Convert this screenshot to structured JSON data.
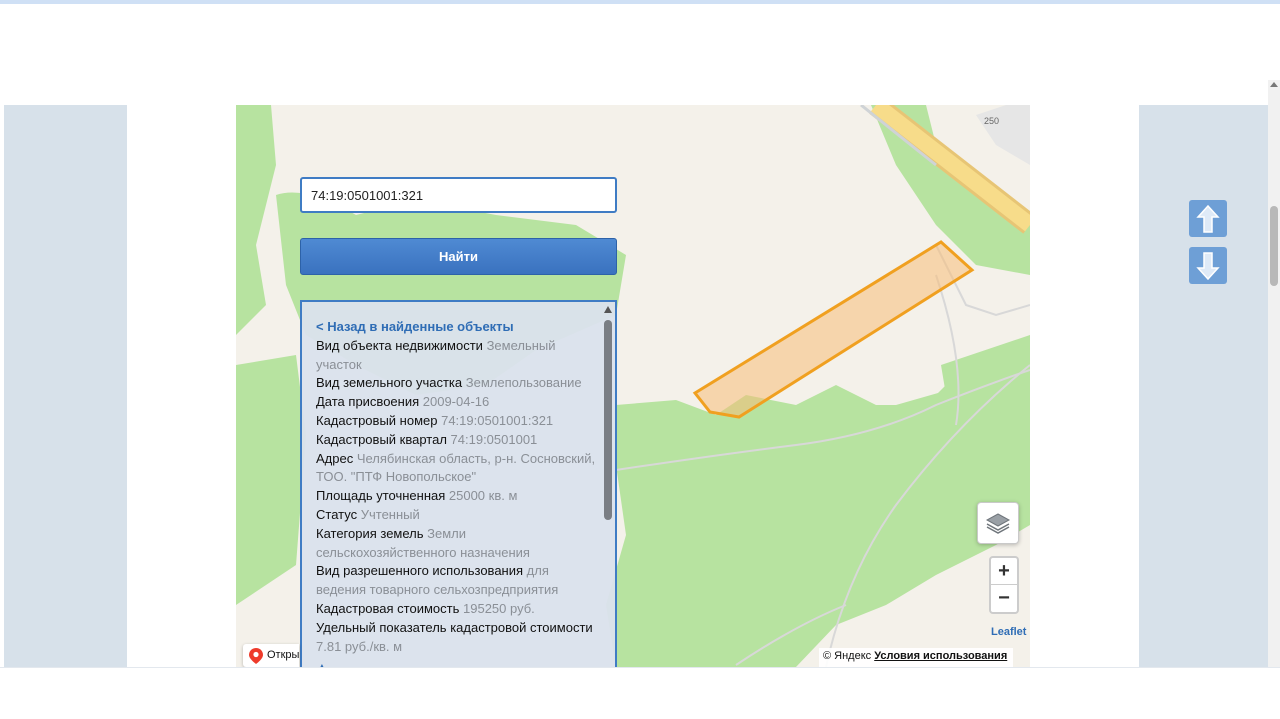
{
  "search": {
    "value": "74:19:0501001:321",
    "button_label": "Найти"
  },
  "info": {
    "back_link": "< Назад в найденные объекты",
    "rows": [
      {
        "label": "Вид объекта недвижимости",
        "value": "Земельный участок"
      },
      {
        "label": "Вид земельного участка",
        "value": "Землепользование"
      },
      {
        "label": "Дата присвоения",
        "value": "2009-04-16"
      },
      {
        "label": "Кадастровый номер",
        "value": "74:19:0501001:321"
      },
      {
        "label": "Кадастровый квартал",
        "value": "74:19:0501001"
      },
      {
        "label": "Адрес",
        "value": "Челябинская область, р-н. Сосновский, ТОО. \"ПТФ Новопольское\""
      },
      {
        "label": "Площадь уточненная",
        "value": "25000 кв. м"
      },
      {
        "label": "Статус",
        "value": "Учтенный"
      },
      {
        "label": "Категория земель",
        "value": "Земли сельскохозяйственного назначения"
      },
      {
        "label": "Вид разрешенного использования",
        "value": "для ведения товарного сельхозпредприятия"
      },
      {
        "label": "Кадастровая стоимость",
        "value": "195250 руб."
      },
      {
        "label": "Удельный показатель кадастровой стоимости",
        "value": "7.81 руб./кв. м"
      }
    ],
    "up_arrow": "▲"
  },
  "map": {
    "road_label": "250",
    "zoom_in": "+",
    "zoom_out": "−",
    "leaflet_label": "Leaflet",
    "attribution_prefix": "© Яндекс",
    "attribution_terms": "Условия использования",
    "open_label": "Открыть в Яндекс.Картах",
    "parcel_color": "#f0a020",
    "forest_color": "#b7e3a0"
  },
  "colors": {
    "accent": "#3f7cc4",
    "nav_arrow": "#6e9fd6"
  }
}
